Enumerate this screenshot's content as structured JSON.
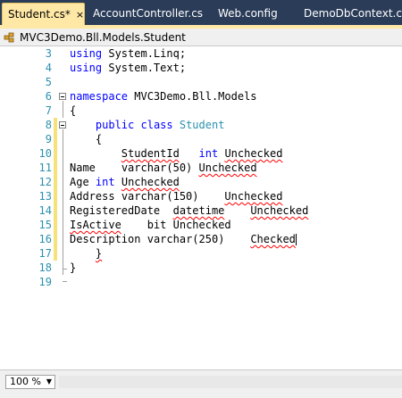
{
  "tabs": [
    {
      "label": "Student.cs*",
      "active": true,
      "close": "×"
    },
    {
      "label": "AccountController.cs",
      "active": false
    },
    {
      "label": "Web.config",
      "active": false
    },
    {
      "label": "DemoDbContext.cs*",
      "active": false
    }
  ],
  "navbar": {
    "type_path": "MVC3Demo.Bll.Models.Student"
  },
  "line_numbers": [
    "3",
    "4",
    "5",
    "6",
    "7",
    "8",
    "9",
    "10",
    "11",
    "12",
    "13",
    "14",
    "15",
    "16",
    "17",
    "18",
    "19"
  ],
  "code": {
    "l3_kw": "using",
    "l3_rest": " System.Linq;",
    "l4_kw": "using",
    "l4_rest": " System.Text;",
    "l6_kw": "namespace",
    "l6_rest": " MVC3Demo.Bll.Models",
    "l7": "{",
    "l8_kw1": "public",
    "l8_kw2": "class",
    "l8_type": "Student",
    "l9": "{",
    "l10_a": "StudentId",
    "l10_kw": "int",
    "l10_b": "Unchecked",
    "l11_a": "Name",
    "l11_b": "varchar(50)",
    "l11_c": "Unchecked",
    "l12_a": "Age",
    "l12_kw": "int",
    "l12_b": "Unchecked",
    "l13_a": "Address",
    "l13_b": "varchar(150)",
    "l13_c": "Unchecked",
    "l14_a": "RegisteredDate",
    "l14_b": "datetime",
    "l14_c": "Unchecked",
    "l15_a": "IsActive",
    "l15_b": "bit",
    "l15_c": "Unchecked",
    "l16_a": "Description",
    "l16_b": "varchar(250)",
    "l16_c": "Checked",
    "l17": "}",
    "l18": "}"
  },
  "status": {
    "zoom": "100 %"
  },
  "colors": {
    "keyword": "#0000ff",
    "type": "#2b91af",
    "line_number": "#2b91af",
    "tab_bg": "#2b3c59",
    "active_tab": "#ffe8a6"
  }
}
